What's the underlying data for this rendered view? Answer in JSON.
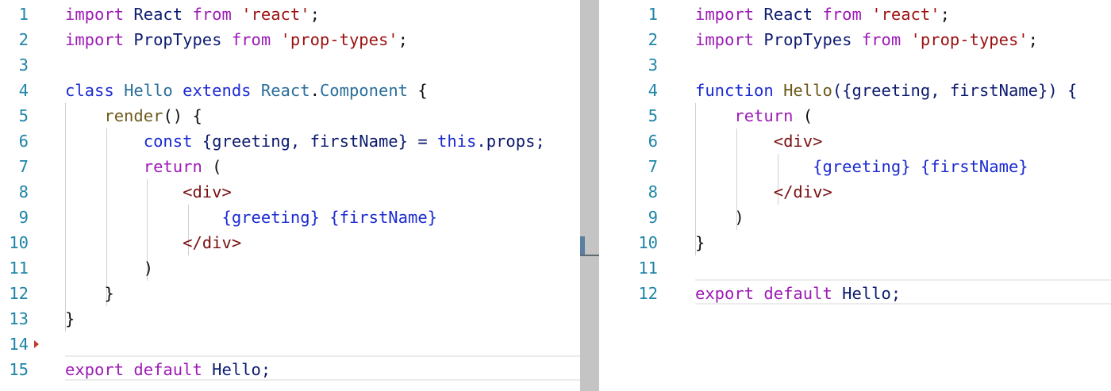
{
  "editor": {
    "left": {
      "lines": [
        {
          "n": "1",
          "tokens": [
            {
              "t": "import",
              "c": "kw"
            },
            {
              "t": " React ",
              "c": "cls"
            },
            {
              "t": "from",
              "c": "kw"
            },
            {
              "t": " ",
              "c": "plain"
            },
            {
              "t": "'react'",
              "c": "str"
            },
            {
              "t": ";",
              "c": "plain"
            }
          ]
        },
        {
          "n": "2",
          "tokens": [
            {
              "t": "import",
              "c": "kw"
            },
            {
              "t": " PropTypes ",
              "c": "cls"
            },
            {
              "t": "from",
              "c": "kw"
            },
            {
              "t": " ",
              "c": "plain"
            },
            {
              "t": "'prop-types'",
              "c": "str"
            },
            {
              "t": ";",
              "c": "plain"
            }
          ]
        },
        {
          "n": "3",
          "tokens": []
        },
        {
          "n": "4",
          "tokens": [
            {
              "t": "class",
              "c": "decl"
            },
            {
              "t": " ",
              "c": "plain"
            },
            {
              "t": "Hello",
              "c": "def"
            },
            {
              "t": " ",
              "c": "plain"
            },
            {
              "t": "extends",
              "c": "decl"
            },
            {
              "t": " ",
              "c": "plain"
            },
            {
              "t": "React",
              "c": "def"
            },
            {
              "t": ".",
              "c": "plain"
            },
            {
              "t": "Component",
              "c": "def"
            },
            {
              "t": " {",
              "c": "plain"
            }
          ]
        },
        {
          "n": "5",
          "tokens": [
            {
              "t": "    ",
              "c": "plain"
            },
            {
              "t": "render",
              "c": "fn"
            },
            {
              "t": "() {",
              "c": "plain"
            }
          ]
        },
        {
          "n": "6",
          "tokens": [
            {
              "t": "        ",
              "c": "plain"
            },
            {
              "t": "const",
              "c": "decl"
            },
            {
              "t": " {greeting, firstName} = ",
              "c": "cls"
            },
            {
              "t": "this",
              "c": "decl"
            },
            {
              "t": ".props;",
              "c": "cls"
            }
          ]
        },
        {
          "n": "7",
          "tokens": [
            {
              "t": "        ",
              "c": "plain"
            },
            {
              "t": "return",
              "c": "kw"
            },
            {
              "t": " (",
              "c": "plain"
            }
          ]
        },
        {
          "n": "8",
          "tokens": [
            {
              "t": "            ",
              "c": "plain"
            },
            {
              "t": "<div>",
              "c": "jsx"
            }
          ]
        },
        {
          "n": "9",
          "tokens": [
            {
              "t": "                ",
              "c": "plain"
            },
            {
              "t": "{greeting}",
              "c": "expr"
            },
            {
              "t": " ",
              "c": "plain"
            },
            {
              "t": "{firstName}",
              "c": "expr"
            }
          ]
        },
        {
          "n": "10",
          "tokens": [
            {
              "t": "            ",
              "c": "plain"
            },
            {
              "t": "</div>",
              "c": "jsx"
            }
          ]
        },
        {
          "n": "11",
          "tokens": [
            {
              "t": "        )",
              "c": "plain"
            }
          ]
        },
        {
          "n": "12",
          "tokens": [
            {
              "t": "    }",
              "c": "plain"
            }
          ]
        },
        {
          "n": "13",
          "tokens": [
            {
              "t": "}",
              "c": "plain"
            }
          ]
        },
        {
          "n": "14",
          "tokens": []
        },
        {
          "n": "15",
          "tokens": [
            {
              "t": "export",
              "c": "kw"
            },
            {
              "t": " ",
              "c": "plain"
            },
            {
              "t": "default",
              "c": "kw"
            },
            {
              "t": " Hello;",
              "c": "cls"
            }
          ]
        }
      ]
    },
    "right": {
      "lines": [
        {
          "n": "1",
          "tokens": [
            {
              "t": "import",
              "c": "kw"
            },
            {
              "t": " React ",
              "c": "cls"
            },
            {
              "t": "from",
              "c": "kw"
            },
            {
              "t": " ",
              "c": "plain"
            },
            {
              "t": "'react'",
              "c": "str"
            },
            {
              "t": ";",
              "c": "plain"
            }
          ]
        },
        {
          "n": "2",
          "tokens": [
            {
              "t": "import",
              "c": "kw"
            },
            {
              "t": " PropTypes ",
              "c": "cls"
            },
            {
              "t": "from",
              "c": "kw"
            },
            {
              "t": " ",
              "c": "plain"
            },
            {
              "t": "'prop-types'",
              "c": "str"
            },
            {
              "t": ";",
              "c": "plain"
            }
          ]
        },
        {
          "n": "3",
          "tokens": []
        },
        {
          "n": "4",
          "tokens": [
            {
              "t": "function",
              "c": "decl"
            },
            {
              "t": " ",
              "c": "plain"
            },
            {
              "t": "Hello",
              "c": "fn"
            },
            {
              "t": "({greeting, firstName}) {",
              "c": "cls"
            }
          ]
        },
        {
          "n": "5",
          "tokens": [
            {
              "t": "    ",
              "c": "plain"
            },
            {
              "t": "return",
              "c": "kw"
            },
            {
              "t": " (",
              "c": "plain"
            }
          ]
        },
        {
          "n": "6",
          "tokens": [
            {
              "t": "        ",
              "c": "plain"
            },
            {
              "t": "<div>",
              "c": "jsx"
            }
          ]
        },
        {
          "n": "7",
          "tokens": [
            {
              "t": "            ",
              "c": "plain"
            },
            {
              "t": "{greeting}",
              "c": "expr"
            },
            {
              "t": " ",
              "c": "plain"
            },
            {
              "t": "{firstName}",
              "c": "expr"
            }
          ]
        },
        {
          "n": "8",
          "tokens": [
            {
              "t": "        ",
              "c": "plain"
            },
            {
              "t": "</div>",
              "c": "jsx"
            }
          ]
        },
        {
          "n": "9",
          "tokens": [
            {
              "t": "    )",
              "c": "plain"
            }
          ]
        },
        {
          "n": "10",
          "tokens": [
            {
              "t": "}",
              "c": "plain"
            }
          ]
        },
        {
          "n": "11",
          "tokens": []
        },
        {
          "n": "12",
          "tokens": [
            {
              "t": "export",
              "c": "kw"
            },
            {
              "t": " ",
              "c": "plain"
            },
            {
              "t": "default",
              "c": "kw"
            },
            {
              "t": " Hello;",
              "c": "cls"
            }
          ]
        }
      ]
    }
  }
}
